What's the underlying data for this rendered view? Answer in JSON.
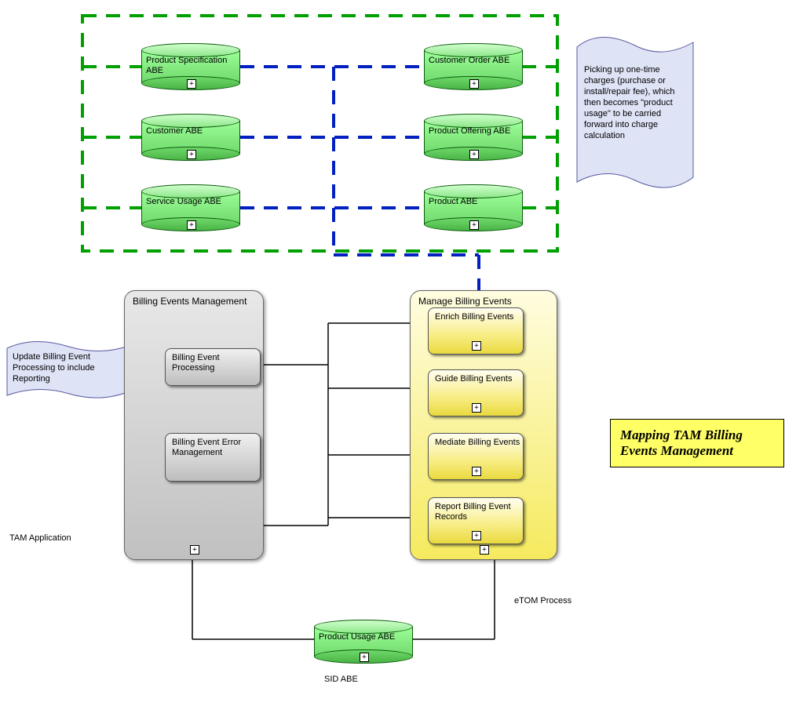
{
  "title_box": "Mapping TAM Billing Events Management",
  "labels": {
    "tam_app": "TAM Application",
    "etom_process": "eTOM Process",
    "sid_abe": "SID ABE"
  },
  "notes": {
    "left_flag": "Update Billing Event Processing to include Reporting",
    "right_flag": "Picking up one-time charges (purchase or install/repair fee), which then becomes \"product usage\" to be carried forward into charge calculation"
  },
  "abe": {
    "product_spec": "Product Specification ABE",
    "customer_order": "Customer Order ABE",
    "customer": "Customer ABE",
    "product_offering": "Product Offering ABE",
    "service_usage": "Service Usage ABE",
    "product": "Product ABE",
    "product_usage": "Product Usage ABE"
  },
  "containers": {
    "billing_events_mgmt": "Billing Events Management",
    "manage_billing_events": "Manage Billing Events"
  },
  "boxes": {
    "billing_event_processing": "Billing Event Processing",
    "billing_event_error_mgmt": "Billing Event Error Management",
    "enrich": "Enrich Billing Events",
    "guide": "Guide Billing Events",
    "mediate": "Mediate Billing Events",
    "report": "Report Billing Event Records"
  },
  "diagram_meta": {
    "green_dashed_group": [
      "product_spec",
      "customer_order",
      "customer",
      "product_offering",
      "service_usage",
      "product"
    ],
    "blue_dashed_links": [
      [
        "product_spec",
        "customer_order"
      ],
      [
        "customer",
        "product_offering"
      ],
      [
        "service_usage",
        "product"
      ]
    ],
    "blue_vertical_to": "manage_billing_events",
    "solid_links_from_processing_to": [
      "enrich",
      "guide",
      "mediate",
      "report"
    ],
    "bottom_links": [
      [
        "billing_events_mgmt",
        "product_usage"
      ],
      [
        "manage_billing_events",
        "product_usage"
      ]
    ]
  }
}
